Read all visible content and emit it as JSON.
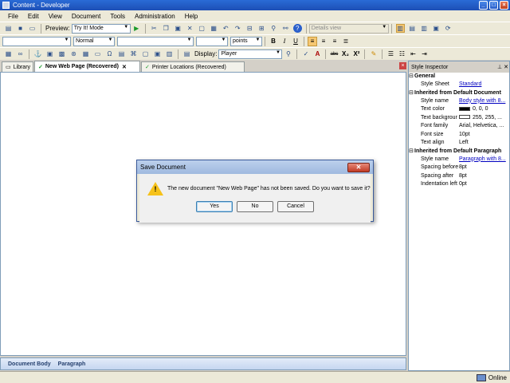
{
  "window": {
    "title": "Content - Developer"
  },
  "menu": [
    "File",
    "Edit",
    "View",
    "Document",
    "Tools",
    "Administration",
    "Help"
  ],
  "toolbar1": {
    "preview_label": "Preview:",
    "preview_value": "Try It! Mode",
    "view_value": "Details view"
  },
  "toolbar2": {
    "style_value": "Normal",
    "size_unit": "points"
  },
  "toolbar3": {
    "display_label": "Display:",
    "display_value": "Player"
  },
  "tabs": [
    {
      "label": "Library"
    },
    {
      "label": "New Web Page (Recovered)"
    },
    {
      "label": "Printer Locations (Recovered)"
    }
  ],
  "statusline": {
    "path1": "Document Body",
    "path2": "Paragraph"
  },
  "inspector": {
    "title": "Style Inspector",
    "general": "General",
    "style_sheet_label": "Style Sheet",
    "style_sheet_value": "Standard",
    "inherited_doc": "Inherited from Default Document",
    "doc_rows": [
      {
        "k": "Style name",
        "v": "Body style with 8..."
      },
      {
        "k": "Text color",
        "v": "0, 0, 0"
      },
      {
        "k": "Text backgrour",
        "v": "255, 255, ..."
      },
      {
        "k": "Font family",
        "v": "Arial, Helvetica, ..."
      },
      {
        "k": "Font size",
        "v": "10pt"
      },
      {
        "k": "Text align",
        "v": "Left"
      }
    ],
    "inherited_para": "Inherited from Default Paragraph",
    "para_rows": [
      {
        "k": "Style name",
        "v": "Paragraph with 8..."
      },
      {
        "k": "Spacing before",
        "v": "8pt"
      },
      {
        "k": "Spacing after",
        "v": "8pt"
      },
      {
        "k": "Indentation left",
        "v": "0pt"
      }
    ],
    "colors": {
      "text": "#000000",
      "background": "#ffffff"
    }
  },
  "status": {
    "online": "Online"
  },
  "dialog": {
    "title": "Save Document",
    "message": "The new document \"New Web Page\" has not been saved. Do you want to save it?",
    "yes": "Yes",
    "no": "No",
    "cancel": "Cancel"
  }
}
